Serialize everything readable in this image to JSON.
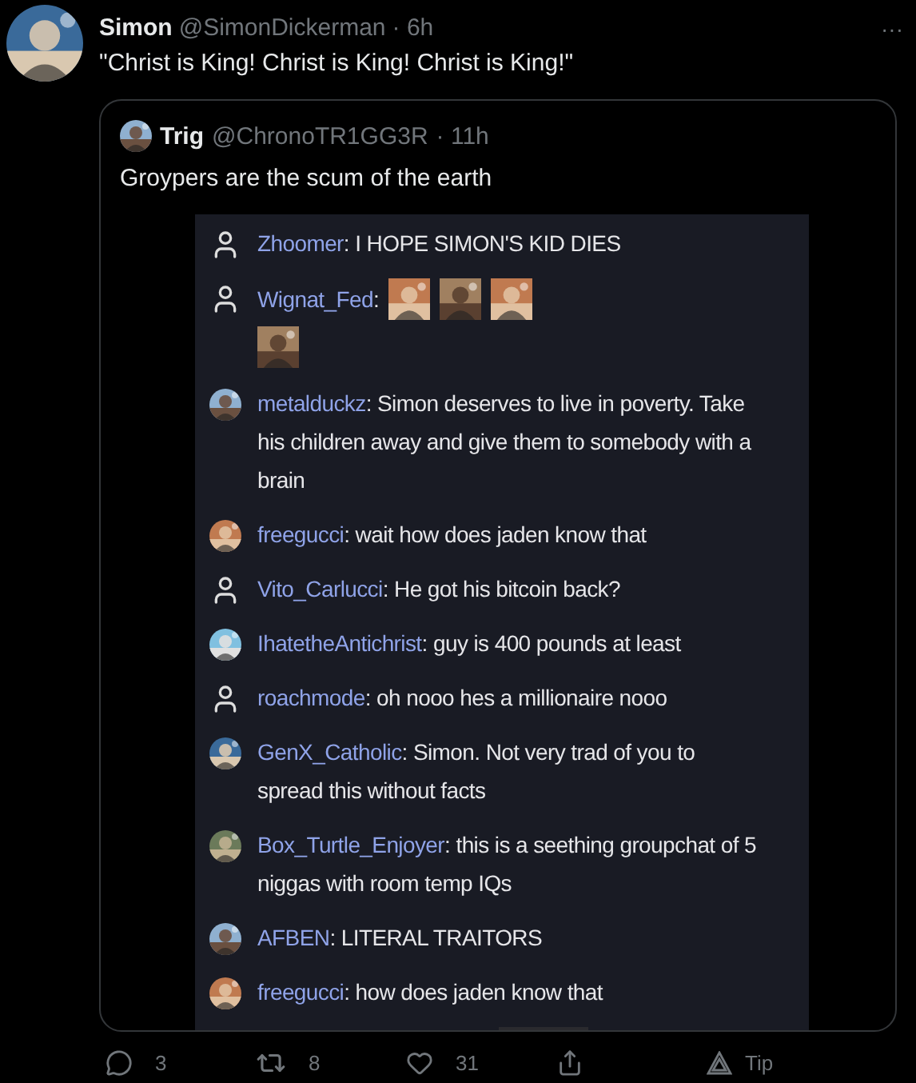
{
  "tweet": {
    "author": "Simon",
    "handle": "@SimonDickerman",
    "time": "· 6h",
    "more": "···",
    "text": "\"Christ is King! Christ is King! Christ is King!\""
  },
  "quote": {
    "author": "Trig",
    "handle": "@ChronoTR1GG3R",
    "time": "· 11h",
    "text": "Groypers are the scum of the earth",
    "chat": [
      {
        "avatar": {
          "kind": "outline"
        },
        "user": "Zhoomer",
        "sep": ":",
        "kind": "text",
        "text": "I HOPE SIMON'S KID DIES"
      },
      {
        "avatar": {
          "kind": "outline"
        },
        "user": "Wignat_Fed",
        "sep": ":",
        "kind": "emotes"
      },
      {
        "user": "metalduckz",
        "sep": ":",
        "kind": "text",
        "text": "Simon deserves to live in poverty. Take his children away and give them to somebody with a brain"
      },
      {
        "user": "freegucci",
        "sep": ":",
        "kind": "text",
        "text": "wait how does jaden know that"
      },
      {
        "avatar": {
          "kind": "outline"
        },
        "user": "Vito_Carlucci",
        "sep": ":",
        "kind": "text",
        "text": "He got his bitcoin back?"
      },
      {
        "user": "IhatetheAntichrist",
        "sep": ":",
        "kind": "text",
        "text": "guy is 400 pounds at least"
      },
      {
        "avatar": {
          "kind": "outline"
        },
        "user": "roachmode",
        "sep": ":",
        "kind": "text",
        "text": "oh nooo hes a millionaire nooo"
      },
      {
        "user": "GenX_Catholic",
        "sep": ":",
        "kind": "text",
        "text": "Simon. Not very trad of you to spread this without facts"
      },
      {
        "user": "Box_Turtle_Enjoyer",
        "sep": ":",
        "kind": "text",
        "text": "this is a seething groupchat of 5 niggas with room temp IQs"
      },
      {
        "user": "AFBEN",
        "sep": ":",
        "kind": "text",
        "text": "LITERAL TRAITORS"
      },
      {
        "user": "freegucci",
        "sep": ":",
        "kind": "text",
        "text": "how does jaden know that"
      }
    ]
  },
  "actions": [
    {
      "kind": "reply",
      "label": "3"
    },
    {
      "kind": "retweet",
      "label": "8"
    },
    {
      "kind": "like",
      "label": "31"
    },
    {
      "kind": "share"
    },
    {
      "kind": "tip",
      "label": "Tip"
    }
  ]
}
